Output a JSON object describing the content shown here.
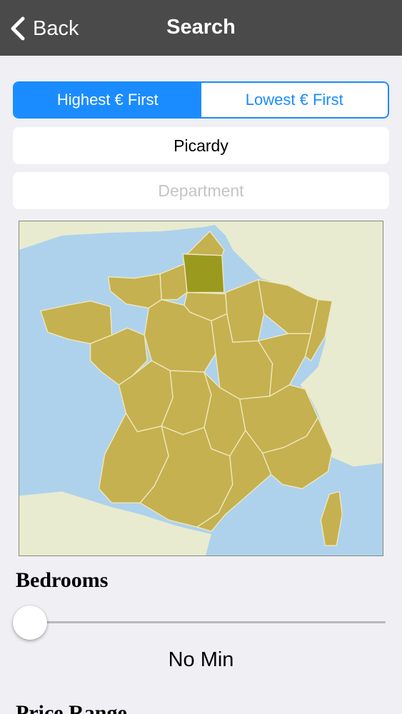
{
  "navbar": {
    "back_label": "Back",
    "title": "Search"
  },
  "sort": {
    "options": [
      "Highest € First",
      "Lowest € First"
    ],
    "selected": "Highest € First"
  },
  "region": {
    "value": "Picardy"
  },
  "department": {
    "value": "",
    "placeholder": "Department"
  },
  "map": {
    "highlighted_region": "Picardy"
  },
  "bedrooms": {
    "title": "Bedrooms",
    "min_label": "No Min",
    "slider_fraction": 0
  },
  "price_range": {
    "title": "Price Range"
  },
  "colors": {
    "accent": "#1a8cff",
    "navbar": "#4a4a4a",
    "region_fill": "#c5b14f",
    "region_highlight": "#9a9a1f",
    "sea": "#aed2ec",
    "land_other": "#e8ebcf"
  }
}
